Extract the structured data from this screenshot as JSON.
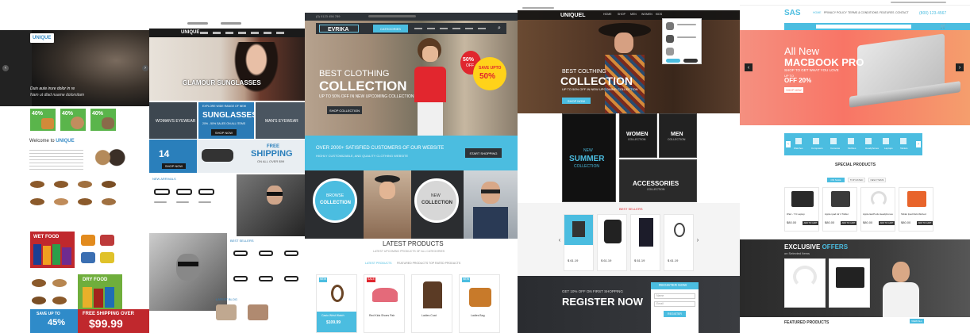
{
  "colors": {
    "accent_blue": "#4bbde0",
    "red": "#e0262e",
    "dark": "#1f2124",
    "coral": "#f96a5a",
    "sunglass_blue": "#1b6ea4"
  },
  "unique": {
    "logo": "UNIQUE",
    "hero_text_1": "Duis aute irure dolor in re",
    "hero_text_2": "Nam ut dlad nuame dolorsitam",
    "promo_1": "40%",
    "promo_2": "40%",
    "promo_3": "40%",
    "welcome_prefix": "Welcome to",
    "welcome_brand": "UNIQUE",
    "wet_food": "WET FOOD",
    "dry_food": "DRY FOOD",
    "save_up_to": "SAVE UP TO",
    "save_percent": "45%",
    "free_shipping_over": "FREE SHIPPING OVER",
    "free_price": "$99.99"
  },
  "sunglasses": {
    "logo": "UNIQUE",
    "hero_title": "GLAMOUR SUNGLASSES",
    "banner_small": "EXPLORE WIDE RANGE OF NEW",
    "banner_title": "SUNGLASSES",
    "banner_sub": "20% - 50% SALES ON ALL ITEMS",
    "shop_now": "SHOP NOW",
    "women_label": "WOMAN'S EYEWEAR",
    "men_label": "MAN'S EYEWEAR",
    "sale_percent": "14",
    "free_shipping": "FREE",
    "shipping": "SHIPPING",
    "on_all_over": "ON ALL OVER $99",
    "new_arrivals": "NEW ARRIVALS",
    "best_sellers": "BEST SELLERS",
    "latest_blog": "LATEST BLOG"
  },
  "evrika": {
    "topbar": "(0) 0123 456 789",
    "logo": "EVRIKA",
    "nav_categories": "CATEGORIES",
    "hero_pre": "BEST CLOTHING",
    "hero_title": "COLLECTION",
    "hero_sub": "UP TO 50% OFF IN NEW UPCOMING COLLECTION",
    "shop_collection": "SHOP COLLECTION",
    "badge_percent": "50%",
    "badge_off": "OFF",
    "save_up_to": "SAVE UPTO",
    "save_percent": "50%",
    "strip_title": "OVER 2000+ SATISFIED CUSTOMERS OF OUR WEBSITE",
    "strip_sub": "HIGHLY CUSTOMIZABLE, AND QUALITY CLOTHING WEBSITE",
    "start_shopping": "START SHOPPING",
    "browse": "BROWSE",
    "collection": "COLLECTION",
    "new": "NEW",
    "latest_products": "LATEST PRODUCTS",
    "latest_sub": "LATEST UPCOMING PRODUCTS OF ALL CATEGORIES",
    "tab_latest": "LATEST PRODUCTS",
    "tab_featured": "FEATURED PRODUCTS",
    "tab_top": "TOP RATED PRODUCTS",
    "products": [
      {
        "name": "Casio Wrist Watch",
        "price": "$109.99",
        "badge": "NEW"
      },
      {
        "name": "Red Kids Shoes Pair",
        "price": "",
        "badge": "SALE"
      },
      {
        "name": "Ladies Coat",
        "price": "",
        "badge": ""
      },
      {
        "name": "Ladies Bag",
        "price": "",
        "badge": "NEW"
      }
    ]
  },
  "uniquel": {
    "logo": "UNIQUEL",
    "nav": [
      "HOME",
      "SHOP",
      "MEN",
      "WOMEN",
      "KIDS"
    ],
    "hero_pre": "BEST COLTHING",
    "hero_title": "COLLECTION",
    "hero_sub": "UP TO 50% OFF IN NEW UPCOMING COLLECTION",
    "shop_now": "SHOP NOW",
    "new_summer_1": "NEW",
    "new_summer_2": "SUMMER",
    "new_summer_3": "COLLECTION",
    "women": "WOMEN",
    "women_sub": "COLLECTION",
    "men": "MEN",
    "men_sub": "COLLECTION",
    "accessories": "ACCESSORIES",
    "accessories_sub": "COLLECTION",
    "best_sellers": "BEST SELLERS",
    "prices": [
      "$ 61.19",
      "$ 61.19",
      "$ 61.19",
      "$ 61.19"
    ],
    "reg_pre": "GET 10% OFF ON FIRST SHOPPING",
    "reg_title": "REGISTER NOW",
    "reg_form_title": "REGISTER NOW",
    "reg_name": "Name",
    "reg_email": "Email",
    "reg_submit": "REGISTER"
  },
  "sas": {
    "logo": "SAS",
    "phone": "(800) 123-4567",
    "nav": [
      "HOME",
      "PRIVACY POLICY",
      "TERMS & CONDITIONS",
      "FEATURES",
      "CONTACT"
    ],
    "hero_pre": "All New",
    "hero_title": "MACBOOK PRO",
    "hero_tag": "SHOP TO GET WHAT YOU LOVE",
    "hero_upto": "UP TO",
    "hero_off": "OFF 20%",
    "shop_now": "SHOP NOW",
    "categories": [
      "Watches",
      "Computers",
      "Cameras",
      "Mobiles",
      "Headphones",
      "Laptops",
      "Tablets"
    ],
    "special_products": "SPECIAL PRODUCTS",
    "special_tabs": [
      "ON SALE",
      "TOP RATED",
      "NEW ITEMS"
    ],
    "products": [
      {
        "name": "iPad - 7.9 Laptop",
        "price": "$80.00"
      },
      {
        "name": "Apple ipad Air 2 Tablet",
        "price": "$80.00"
      },
      {
        "name": "Apple EarPods Headphones",
        "price": "$80.00"
      },
      {
        "name": "Tablet Ipad Refurbished",
        "price": "$80.00"
      }
    ],
    "add_to_cart": "ADD TO CART",
    "exclusive": "EXCLUSIVE",
    "offers": "OFFERS",
    "exclusive_sub": "on Selected Items",
    "featured_products": "FEATURED PRODUCTS",
    "view_all": "VIEW ALL"
  }
}
